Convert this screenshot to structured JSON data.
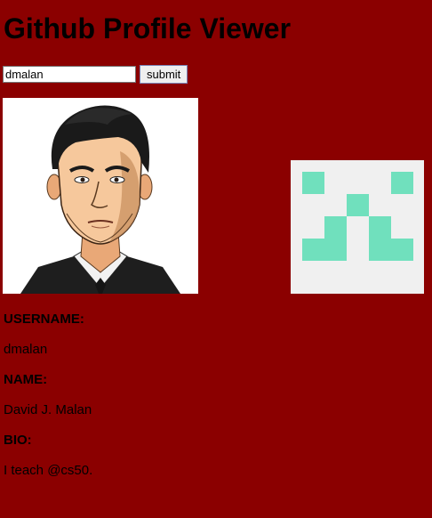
{
  "page": {
    "title": "Github Profile Viewer"
  },
  "search": {
    "value": "dmalan",
    "submit_label": "submit"
  },
  "profile": {
    "avatar_icon": "person-portrait",
    "identicon_icon": "github-identicon",
    "identicon_color": "#70e0bd",
    "fields": [
      {
        "label": "USERNAME:",
        "value": "dmalan"
      },
      {
        "label": "NAME:",
        "value": "David J. Malan"
      },
      {
        "label": "BIO:",
        "value": "I teach @cs50."
      }
    ]
  },
  "colors": {
    "background": "#8b0000"
  }
}
